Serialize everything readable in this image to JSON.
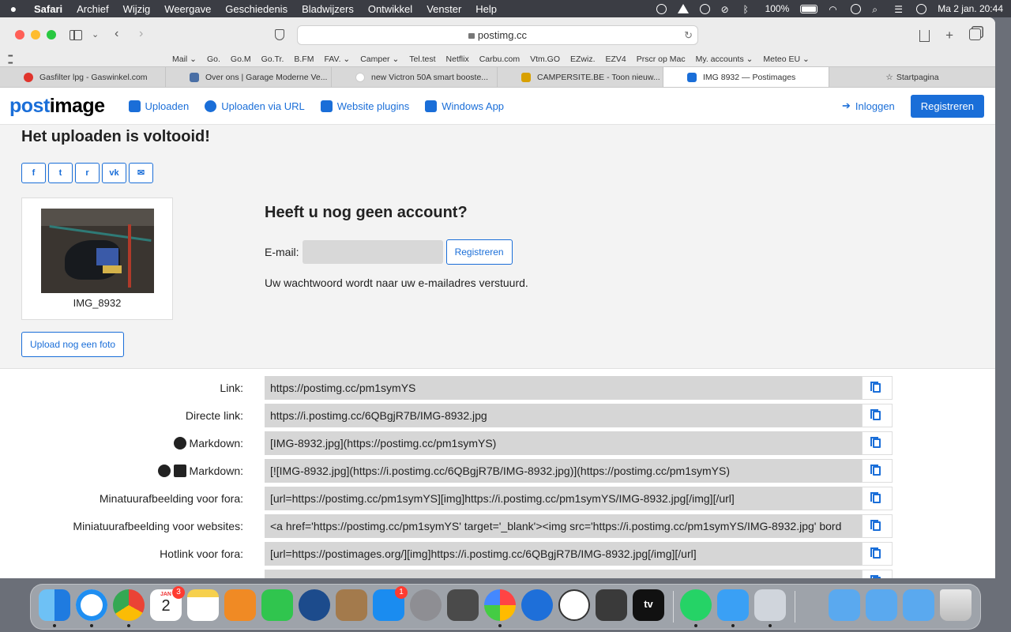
{
  "menubar": {
    "apple": "",
    "items": [
      "Safari",
      "Archief",
      "Wijzig",
      "Weergave",
      "Geschiedenis",
      "Bladwijzers",
      "Ontwikkel",
      "Venster",
      "Help"
    ],
    "battery": "100%",
    "datetime": "Ma 2 jan.  20:44"
  },
  "browser": {
    "url": "postimg.cc",
    "favorites": [
      "Mail ⌄",
      "Go.",
      "Go.M",
      "Go.Tr.",
      "B.FM",
      "FAV. ⌄",
      "Camper ⌄",
      "Tel.test",
      "Netflix",
      "Carbu.com",
      "Vtm.GO",
      "EZwiz.",
      "EZV4",
      "Prscr op Mac",
      "My. accounts ⌄",
      "Meteo EU ⌄"
    ],
    "tabs": [
      {
        "title": "Gasfilter lpg - Gaswinkel.com",
        "color": "#e0342c"
      },
      {
        "title": "Over ons | Garage Moderne Ve...",
        "color": "#4a6fa5"
      },
      {
        "title": "new Victron 50A smart booste...",
        "color": "#ffffff"
      },
      {
        "title": "CAMPERSITE.BE - Toon nieuw...",
        "color": "#d8a000"
      },
      {
        "title": "IMG 8932 — Postimages",
        "color": "#1a6ed8"
      }
    ],
    "start_tab": "Startpagina"
  },
  "site": {
    "logo_a": "post",
    "logo_b": "image",
    "nav": [
      "Uploaden",
      "Uploaden via URL",
      "Website plugins",
      "Windows App"
    ],
    "login": "Inloggen",
    "register": "Registreren"
  },
  "upload": {
    "title": "Het uploaden is voltooid!",
    "social": [
      "f",
      "t",
      "r",
      "vk",
      "✉"
    ],
    "image_name": "IMG_8932",
    "upload_again": "Upload nog een foto",
    "account_title": "Heeft u nog geen account?",
    "email_label": "E-mail:",
    "email_value": "",
    "email_button": "Registreren",
    "password_note": "Uw wachtwoord wordt naar uw e-mailadres verstuurd."
  },
  "links": [
    {
      "label": "Link:",
      "value": "https://postimg.cc/pm1symYS"
    },
    {
      "label": "Directe link:",
      "value": "https://i.postimg.cc/6QBgjR7B/IMG-8932.jpg"
    },
    {
      "label": "Markdown:",
      "value": "[IMG-8932.jpg](https://postimg.cc/pm1symYS)",
      "icon": "reddit-icon"
    },
    {
      "label": "Markdown:",
      "value": "[![IMG-8932.jpg](https://i.postimg.cc/6QBgjR7B/IMG-8932.jpg)](https://postimg.cc/pm1symYS)",
      "icon": "github-stackoverflow-icons"
    },
    {
      "label": "Minatuurafbeelding voor fora:",
      "value": "[url=https://postimg.cc/pm1symYS][img]https://i.postimg.cc/pm1symYS/IMG-8932.jpg[/img][/url]"
    },
    {
      "label": "Miniatuurafbeelding voor websites:",
      "value": "<a href='https://postimg.cc/pm1symYS' target='_blank'><img src='https://i.postimg.cc/pm1symYS/IMG-8932.jpg' bord"
    },
    {
      "label": "Hotlink voor fora:",
      "value": "[url=https://postimages.org/][img]https://i.postimg.cc/6QBgjR7B/IMG-8932.jpg[/img][/url]"
    }
  ],
  "dock": {
    "calendar_month": "JAN",
    "calendar_day": "2",
    "calendar_badge": "3",
    "appstore_badge": "1",
    "tv_label": "tv"
  }
}
